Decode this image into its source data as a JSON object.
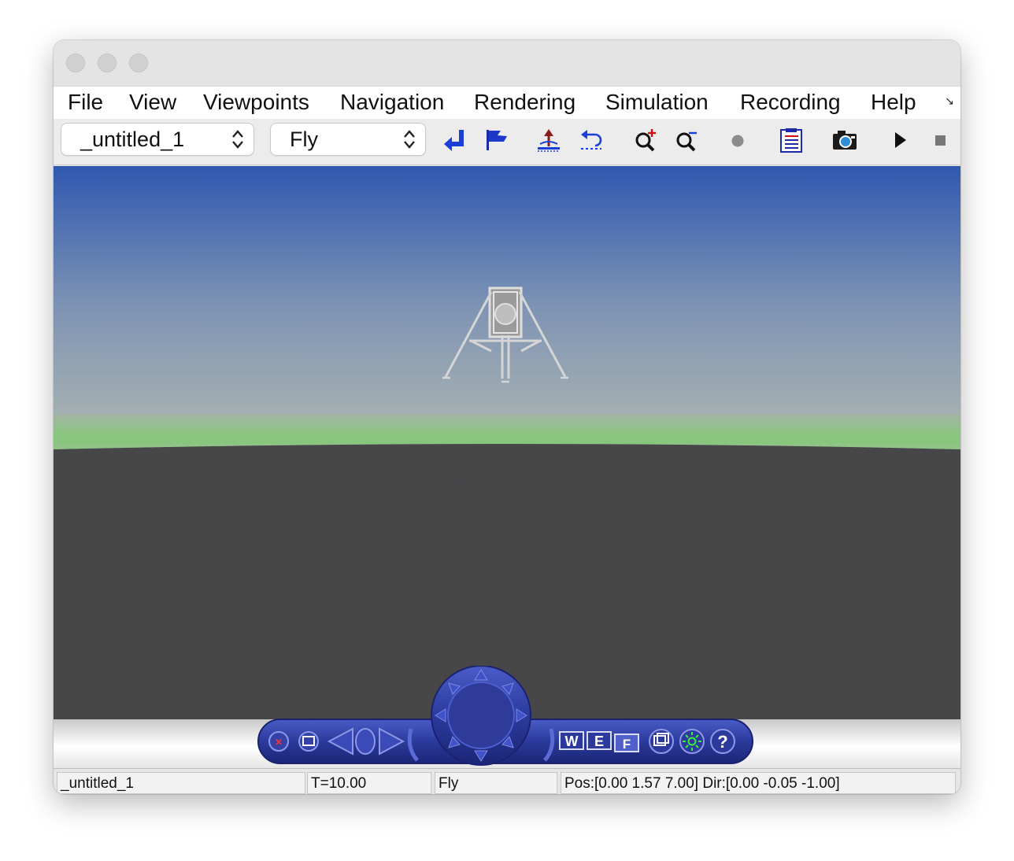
{
  "menubar": {
    "items": [
      "File",
      "View",
      "Viewpoints",
      "Navigation",
      "Rendering",
      "Simulation",
      "Recording",
      "Help"
    ]
  },
  "toolbar": {
    "viewpoint_select": "_untitled_1",
    "navigation_select": "Fly",
    "icons": [
      "return-icon",
      "flag-icon",
      "ground-anchor-icon",
      "undo-icon",
      "zoom-in-icon",
      "zoom-out-icon",
      "record-dot-icon",
      "clipboard-icon",
      "camera-icon",
      "play-icon",
      "stop-icon"
    ]
  },
  "scene": {
    "sky_top": "#2f58b0",
    "sky_bottom": "#a5b0b1",
    "horizon_green": "#8ac77f",
    "ground": "#4a4a4c"
  },
  "navbar": {
    "walk_label": "W",
    "examine_label": "E",
    "fly_label": "F",
    "help_label": "?",
    "color": "#2b3a9c"
  },
  "statusbar": {
    "world": "_untitled_1",
    "time": "T=10.00",
    "mode": "Fly",
    "pose": "Pos:[0.00 1.57 7.00] Dir:[0.00 -0.05 -1.00]"
  }
}
